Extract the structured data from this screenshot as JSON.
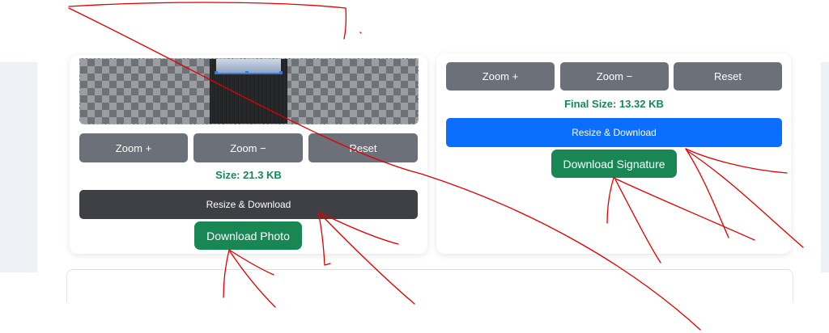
{
  "photo_panel": {
    "zoom_in_label": "Zoom +",
    "zoom_out_label": "Zoom −",
    "reset_label": "Reset",
    "size_text": "Size: 21.3 KB",
    "resize_download_label": "Resize & Download",
    "download_label": "Download Photo"
  },
  "signature_panel": {
    "zoom_in_label": "Zoom +",
    "zoom_out_label": "Zoom −",
    "reset_label": "Reset",
    "size_text": "Final Size: 13.32 KB",
    "resize_download_label": "Resize & Download",
    "download_label": "Download Signature"
  },
  "colors": {
    "green": "#198754",
    "blue": "#0b6efd",
    "gray_button": "#6b7079",
    "dark_button": "#3f4046",
    "annotation_red": "#e00000"
  }
}
